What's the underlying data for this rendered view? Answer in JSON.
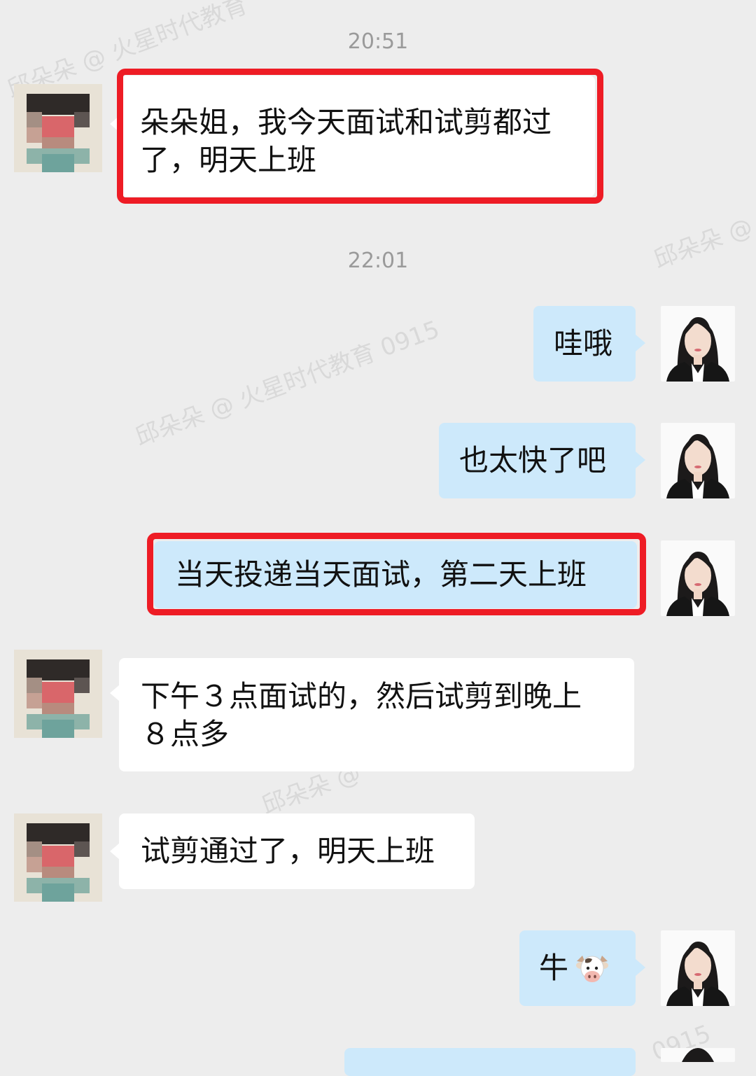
{
  "watermarks": [
    "邱朵朵 @ 火星时代教育",
    "邱朵朵 @ 火星时代教育 0915",
    "邱朵朵 @",
    "邱朵朵 @",
    "0915"
  ],
  "timestamps": [
    "20:51",
    "22:01"
  ],
  "messages": [
    {
      "side": "left",
      "text": "朵朵姐，我今天面试和试剪都过了，明天上班",
      "highlighted": true
    },
    {
      "side": "right",
      "text": "哇哦",
      "highlighted": false
    },
    {
      "side": "right",
      "text": "也太快了吧",
      "highlighted": false
    },
    {
      "side": "right",
      "text": "当天投递当天面试，第二天上班",
      "highlighted": true
    },
    {
      "side": "left",
      "text": "下午３点面试的，然后试剪到晚上８点多",
      "highlighted": false
    },
    {
      "side": "left",
      "text": "试剪通过了，明天上班",
      "highlighted": false
    },
    {
      "side": "right",
      "text": "牛",
      "emoji": "cow-face",
      "highlighted": false
    }
  ],
  "colors": {
    "background": "#ededed",
    "bubble_left": "#ffffff",
    "bubble_right": "#cde9fb",
    "highlight_border": "#ee1c25",
    "timestamp": "#9a9a9a"
  }
}
